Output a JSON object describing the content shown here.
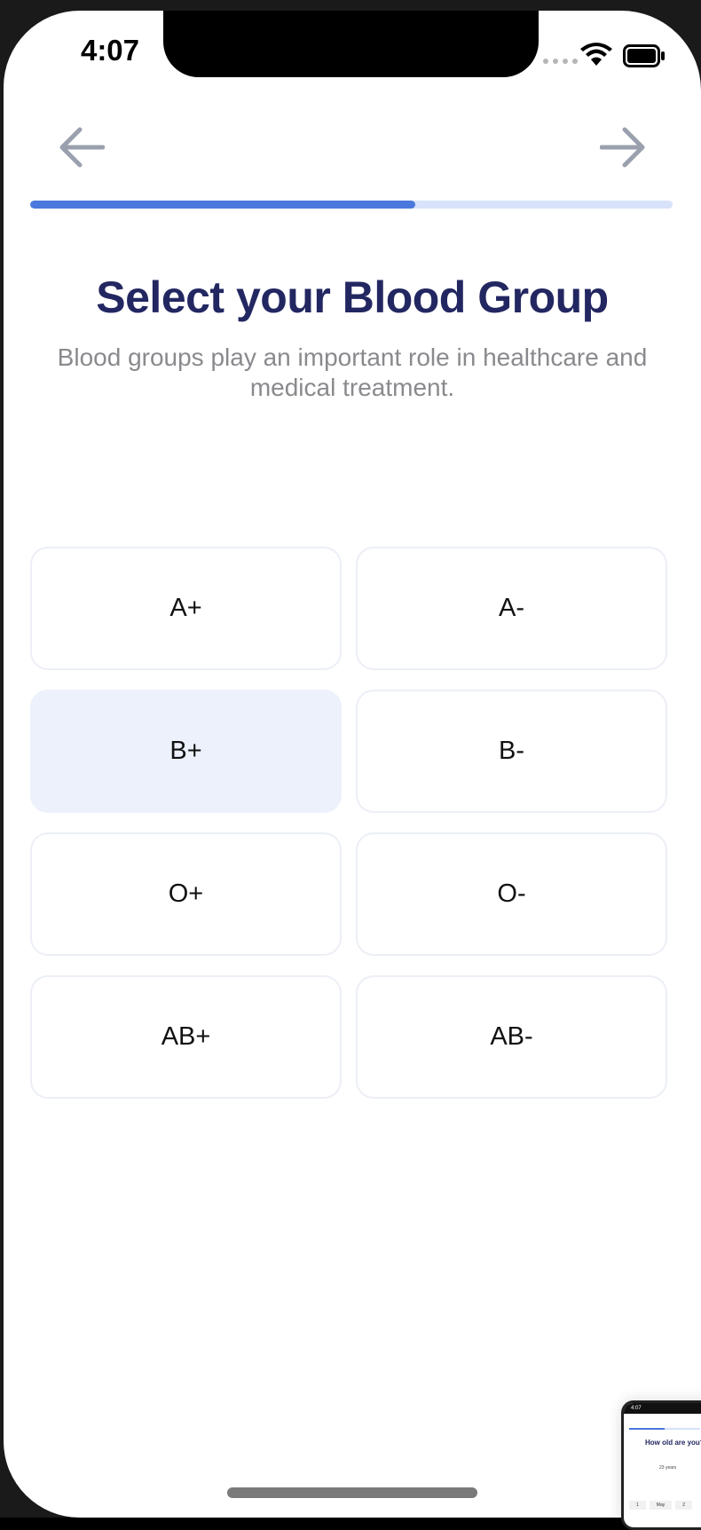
{
  "status_bar": {
    "time": "4:07"
  },
  "nav": {
    "back_icon": "arrow-left-icon",
    "next_icon": "arrow-right-icon"
  },
  "progress": {
    "value": 0.6
  },
  "header": {
    "title": "Select your Blood Group",
    "subtitle": "Blood groups play an important role in healthcare and medical treatment."
  },
  "blood_groups": [
    {
      "label": "A+",
      "selected": false
    },
    {
      "label": "A-",
      "selected": false
    },
    {
      "label": "B+",
      "selected": true
    },
    {
      "label": "B-",
      "selected": false
    },
    {
      "label": "O+",
      "selected": false
    },
    {
      "label": "O-",
      "selected": false
    },
    {
      "label": "AB+",
      "selected": false
    },
    {
      "label": "AB-",
      "selected": false
    }
  ],
  "colors": {
    "accent": "#4a78dc",
    "track": "#d8e2fa",
    "title": "#232761",
    "selected_bg": "#ecf1fc"
  },
  "thumbnail": {
    "time": "4:07",
    "title": "How old are you?",
    "value": "23 years",
    "picker": [
      "1",
      "May",
      "2"
    ]
  }
}
